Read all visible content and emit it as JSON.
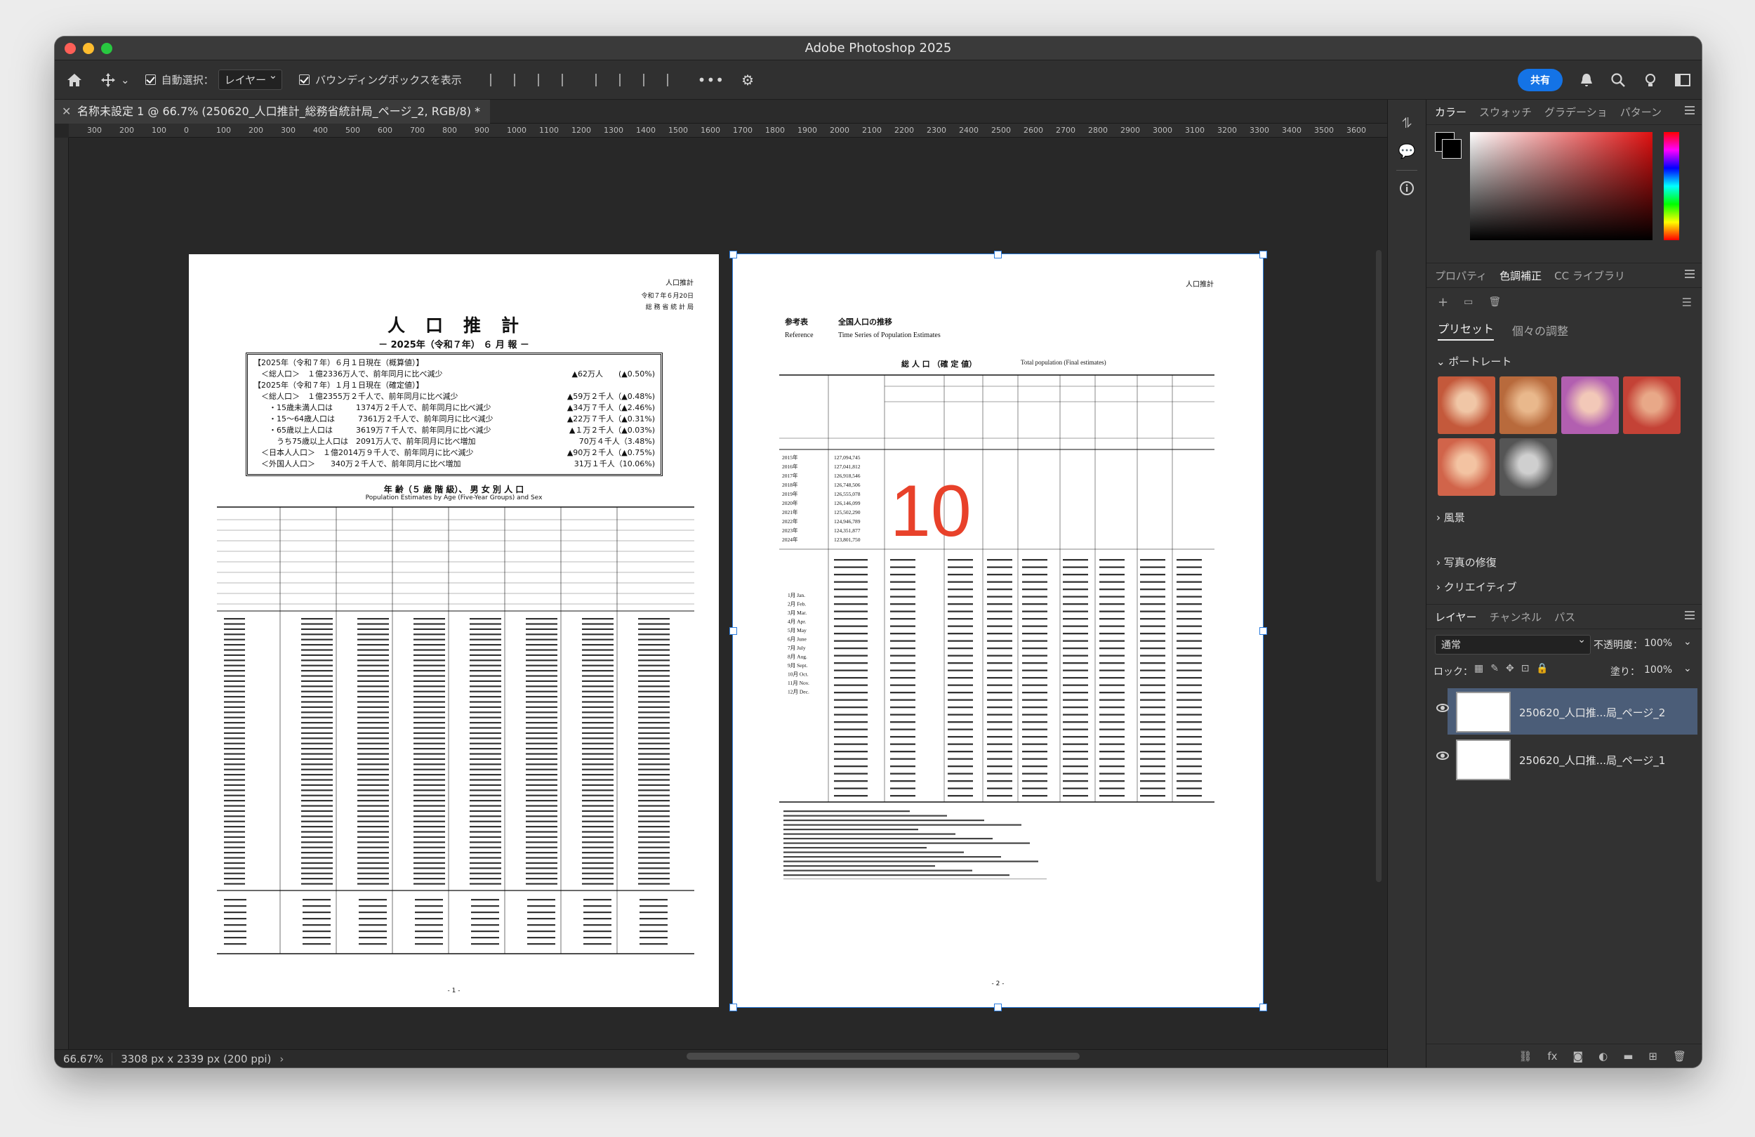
{
  "window": {
    "title": "Adobe Photoshop 2025"
  },
  "options": {
    "auto_select_label": "自動選択：",
    "auto_select_value": "レイヤー",
    "bbox_label": "バウンディングボックスを表示",
    "share_label": "共有"
  },
  "document_tab": {
    "title": "名称未設定 1 @ 66.7% (250620_人口推計_総務省統計局_ページ_2, RGB/8) *"
  },
  "ruler": {
    "marks": [
      "300",
      "200",
      "100",
      "0",
      "100",
      "200",
      "300",
      "400",
      "500",
      "600",
      "700",
      "800",
      "900",
      "1000",
      "1100",
      "1200",
      "1300",
      "1400",
      "1500",
      "1600",
      "1700",
      "1800",
      "1900",
      "2000",
      "2100",
      "2200",
      "2300",
      "2400",
      "2500",
      "2600",
      "2700",
      "2800",
      "2900",
      "3000",
      "3100",
      "3200",
      "3300",
      "3400",
      "3500",
      "3600"
    ]
  },
  "status": {
    "zoom": "66.67%",
    "doc_size": "3308 px x 2339 px (200 ppi)"
  },
  "panels": {
    "color_tabs": [
      "カラー",
      "スウォッチ",
      "グラデーショ",
      "パターン"
    ],
    "adjust_tabs": [
      "プロパティ",
      "色調補正",
      "CC ライブラリ"
    ],
    "preset_tabs": [
      "プリセット",
      "個々の調整"
    ],
    "sections": [
      "ポートレート",
      "風景",
      "写真の修復",
      "クリエイティブ"
    ],
    "layer_tabs": [
      "レイヤー",
      "チャンネル",
      "パス"
    ],
    "blend_mode": "通常",
    "opacity_label": "不透明度：",
    "opacity_value": "100%",
    "lock_label": "ロック：",
    "fill_label": "塗り：",
    "fill_value": "100%",
    "layers": [
      {
        "name": "250620_人口推...局_ページ_2",
        "selected": true
      },
      {
        "name": "250620_人口推...局_ページ_1",
        "selected": false
      }
    ]
  },
  "overlay_text": "10",
  "page1": {
    "corner": "人口推計",
    "date_line1": "令和７年６月20日",
    "date_line2": "総 務 省 統 計 局",
    "title": "人　口　推　計",
    "subtitle": "－ 2025年（令和７年） ６ 月 報 －",
    "box": [
      [
        "【2025年（令和７年）６月１日現在（概算値）】",
        ""
      ],
      [
        "　＜総人口＞　１億2336万人で、前年同月に比べ減少",
        "▲62万人　　(▲0.50%)"
      ],
      [
        "【2025年（令和７年）１月１日現在（確定値）】",
        ""
      ],
      [
        "　＜総人口＞　１億2355万２千人で、前年同月に比べ減少",
        "▲59万２千人（▲0.48%)"
      ],
      [
        "　　・15歳未満人口は　　　1374万２千人で、前年同月に比べ減少",
        "▲34万７千人（▲2.46%)"
      ],
      [
        "　　・15～64歳人口は　　　7361万２千人で、前年同月に比べ減少",
        "▲22万７千人（▲0.31%)"
      ],
      [
        "　　・65歳以上人口は　　　3619万７千人で、前年同月に比べ減少",
        "▲１万２千人（▲0.03%)"
      ],
      [
        "　　　うち75歳以上人口は　2091万人で、前年同月に比べ増加",
        "70万４千人（3.48%)"
      ],
      [
        "　＜日本人人口＞　１億2014万９千人で、前年同月に比べ減少",
        "▲90万２千人（▲0.75%)"
      ],
      [
        "　＜外国人人口＞　　340万２千人で、前年同月に比べ増加",
        "31万１千人（10.06%)"
      ]
    ],
    "table_title": "年 齢（５ 歳 階 級）、 男 女 別 人 口",
    "table_subtitle": "Population Estimates by Age (Five-Year Groups) and Sex",
    "footer": "- 1 -"
  },
  "page2": {
    "corner": "人口推計",
    "ref_label": "参考表",
    "ref_title": "全国人口の推移",
    "ref_en_label": "Reference",
    "ref_en_title": "Time Series of Population Estimates",
    "table_title": "総 人 口 （確 定 値）",
    "table_title_en": "Total population (Final estimates)",
    "years": [
      "2015年",
      "2016年",
      "2017年",
      "2018年",
      "2019年",
      "2020年",
      "2021年",
      "2022年",
      "2023年",
      "2024年"
    ],
    "pops": [
      "127,094,745",
      "127,041,812",
      "126,918,546",
      "126,748,506",
      "126,555,078",
      "126,146,099",
      "125,502,290",
      "124,946,789",
      "124,351,877",
      "123,801,750"
    ],
    "months_2024": [
      "1月 Jan.",
      "2月 Feb.",
      "3月 Mar.",
      "4月 Apr.",
      "5月 May",
      "6月 June",
      "7月 July",
      "8月 Aug.",
      "9月 Sept.",
      "10月 Oct.",
      "11月 Nov.",
      "12月 Dec."
    ],
    "footer": "- 2 -"
  }
}
